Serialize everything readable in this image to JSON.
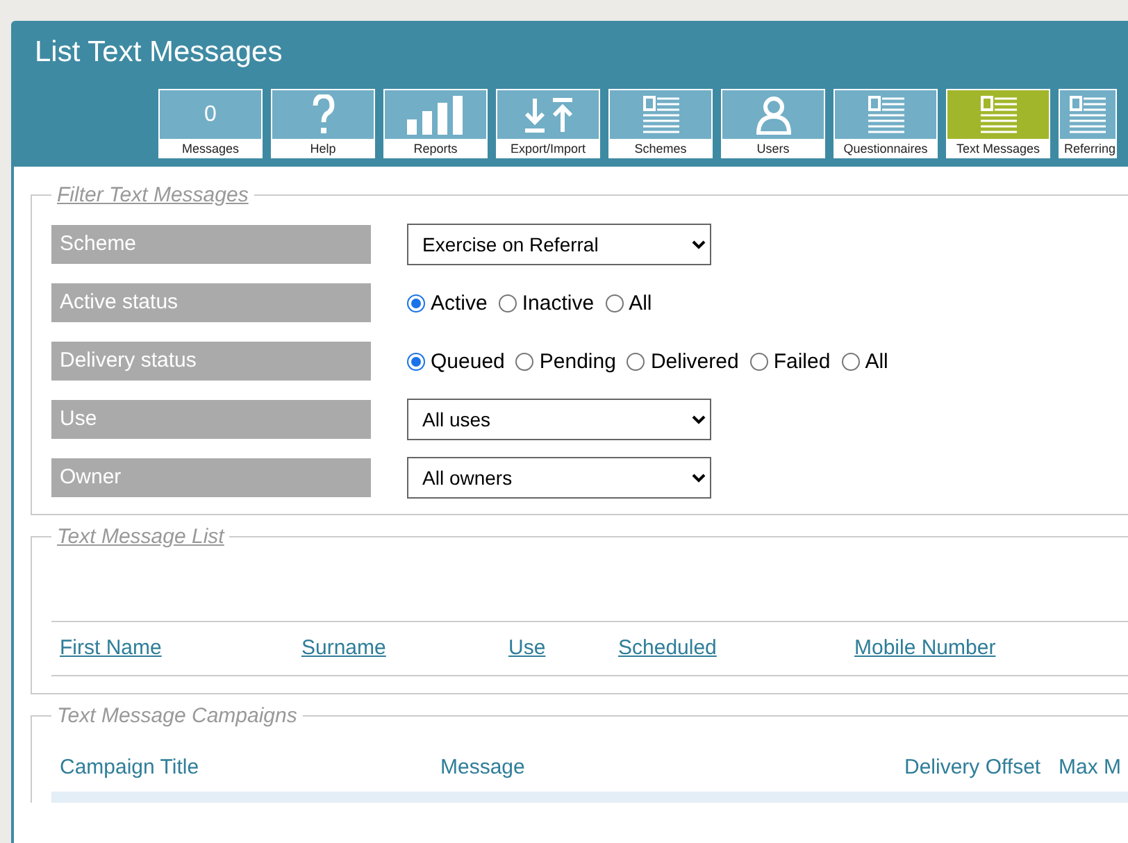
{
  "window": {
    "title": "List Text Messages"
  },
  "toolbar": [
    {
      "kind": "count",
      "count": "0",
      "label": "Messages",
      "selected": false
    },
    {
      "kind": "icon",
      "label": "Help",
      "selected": false
    },
    {
      "kind": "icon",
      "label": "Reports",
      "selected": false
    },
    {
      "kind": "icon",
      "label": "Export/Import",
      "selected": false
    },
    {
      "kind": "icon",
      "label": "Schemes",
      "selected": false
    },
    {
      "kind": "icon",
      "label": "Users",
      "selected": false
    },
    {
      "kind": "icon",
      "label": "Questionnaires",
      "selected": false
    },
    {
      "kind": "icon",
      "label": "Text Messages",
      "selected": true
    },
    {
      "kind": "icon",
      "label": "Referring",
      "selected": false
    }
  ],
  "filter": {
    "legend": "Filter Text Messages",
    "underlined": true,
    "rows": [
      {
        "label": "Scheme",
        "kind": "select",
        "value": "Exercise on Referral"
      },
      {
        "label": "Active status",
        "kind": "radio",
        "options": [
          {
            "label": "Active",
            "selected": true
          },
          {
            "label": "Inactive",
            "selected": false
          },
          {
            "label": "All",
            "selected": false
          }
        ]
      },
      {
        "label": "Delivery status",
        "kind": "radio",
        "options": [
          {
            "label": "Queued",
            "selected": true
          },
          {
            "label": "Pending",
            "selected": false
          },
          {
            "label": "Delivered",
            "selected": false
          },
          {
            "label": "Failed",
            "selected": false
          },
          {
            "label": "All",
            "selected": false
          }
        ]
      },
      {
        "label": "Use",
        "kind": "select",
        "value": "All uses"
      },
      {
        "label": "Owner",
        "kind": "select",
        "value": "All owners"
      }
    ]
  },
  "message_list": {
    "legend": "Text Message List",
    "underlined": true,
    "columns": [
      "First Name",
      "Surname",
      "Use",
      "Scheduled",
      "Mobile Number"
    ]
  },
  "campaigns": {
    "legend": "Text Message Campaigns",
    "underlined": false,
    "columns": [
      "Campaign Title",
      "Message",
      "Delivery Offset",
      "Max M"
    ]
  }
}
